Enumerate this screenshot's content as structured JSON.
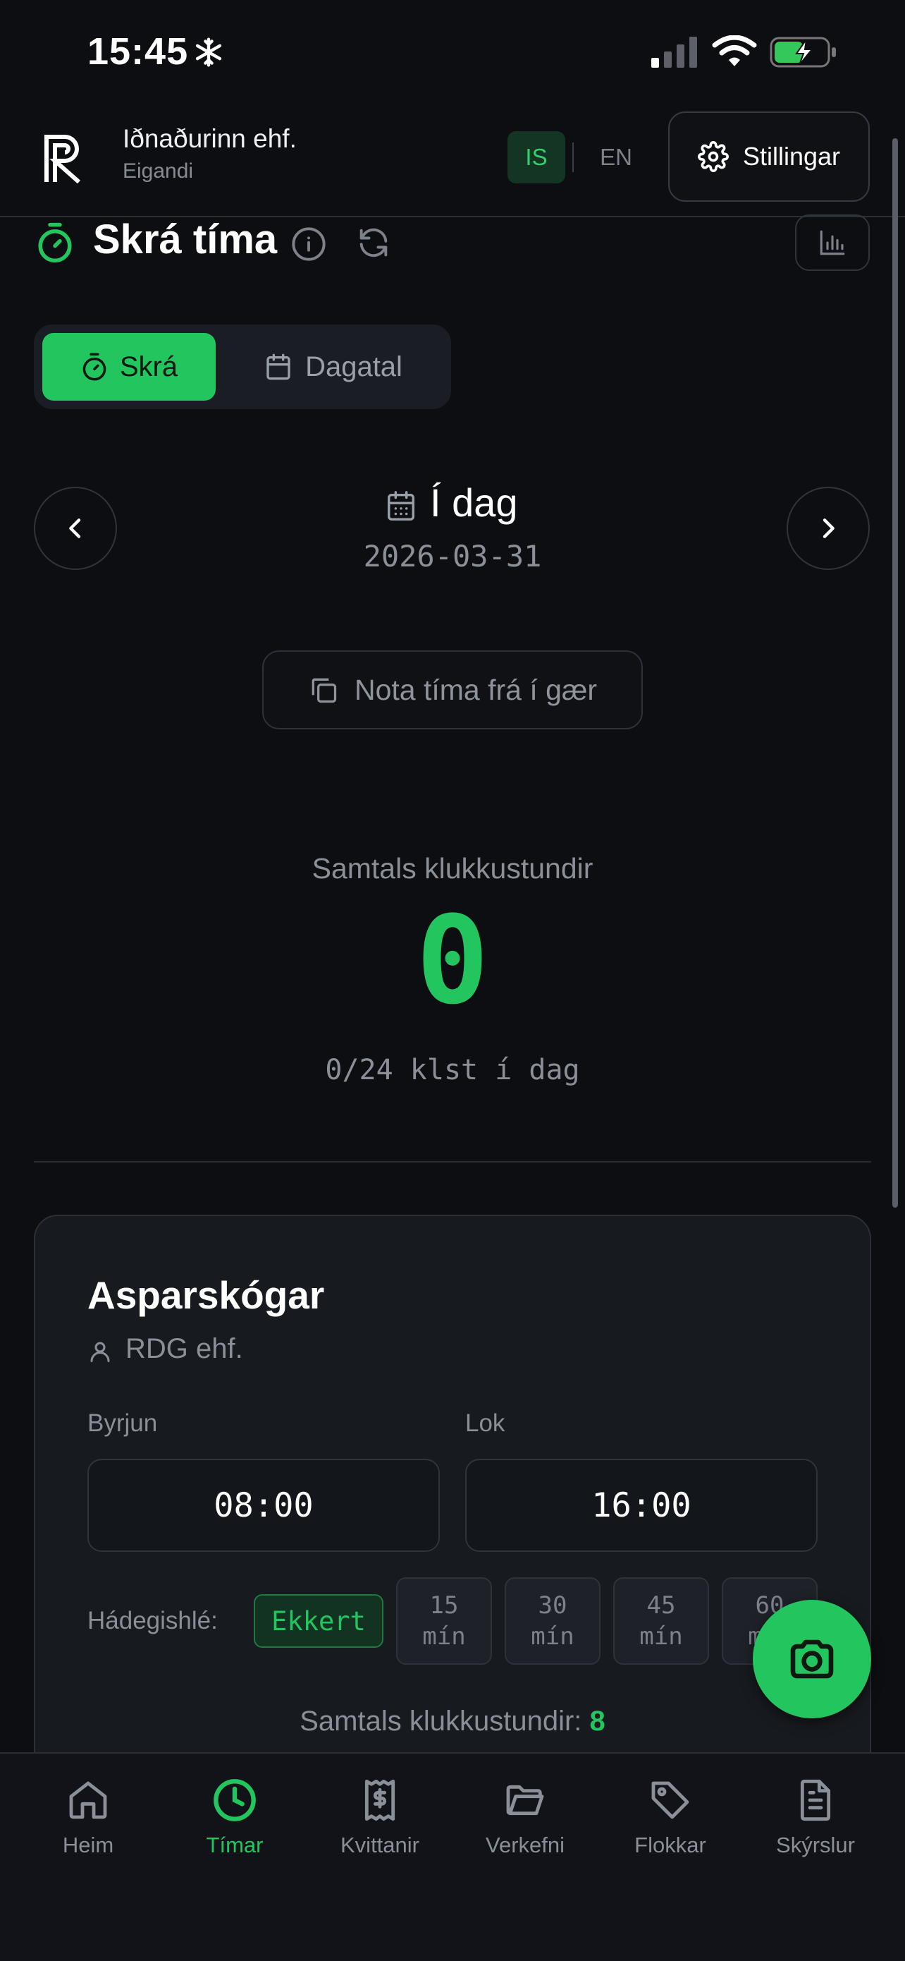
{
  "status_bar": {
    "time": "15:45",
    "icons": [
      "snowflake-icon",
      "signal-icon",
      "wifi-icon",
      "battery-charging-icon"
    ]
  },
  "header": {
    "logo": "R logo",
    "company_name": "Iðnaðurinn ehf.",
    "role": "Eigandi",
    "lang_is": "IS",
    "lang_en": "EN",
    "settings_label": "Stillingar",
    "active_lang": "IS"
  },
  "page": {
    "title": "Skrá tíma",
    "icons": [
      "timer-icon",
      "info-icon",
      "refresh-icon",
      "bar-chart-icon"
    ]
  },
  "tabs": [
    {
      "label": "Skrá",
      "icon": "timer-icon",
      "active": true
    },
    {
      "label": "Dagatal",
      "icon": "calendar-icon",
      "active": false
    }
  ],
  "date_nav": {
    "label": "Í dag",
    "date": "2026-03-31"
  },
  "copy_button": "Nota tíma frá í gær",
  "summary": {
    "label": "Samtals klukkustundir",
    "value": "0",
    "sub": "0/24 klst í dag"
  },
  "project_card": {
    "name": "Asparskógar",
    "client": "RDG ehf.",
    "start_label": "Byrjun",
    "end_label": "Lok",
    "start_value": "08:00",
    "end_value": "16:00",
    "lunch_label": "Hádegishlé:",
    "lunch_options": [
      {
        "label": "Ekkert",
        "selected": true
      },
      {
        "line1": "15",
        "line2": "mín",
        "selected": false
      },
      {
        "line1": "30",
        "line2": "mín",
        "selected": false
      },
      {
        "line1": "45",
        "line2": "mín",
        "selected": false
      },
      {
        "line1": "60",
        "line2": "mín",
        "selected": false
      }
    ],
    "total_label": "Samtals klukkustundir:",
    "total_value": "8"
  },
  "bottom_nav": [
    {
      "label": "Heim",
      "icon": "home-icon",
      "active": false
    },
    {
      "label": "Tímar",
      "icon": "clock-icon",
      "active": true
    },
    {
      "label": "Kvittanir",
      "icon": "receipt-icon",
      "active": false
    },
    {
      "label": "Verkefni",
      "icon": "folder-icon",
      "active": false
    },
    {
      "label": "Flokkar",
      "icon": "tag-icon",
      "active": false
    },
    {
      "label": "Skýrslur",
      "icon": "document-icon",
      "active": false
    }
  ],
  "colors": {
    "accent": "#22c55e",
    "background": "#0c0e12",
    "card": "#171a1f",
    "muted_text": "#8a8f98"
  }
}
